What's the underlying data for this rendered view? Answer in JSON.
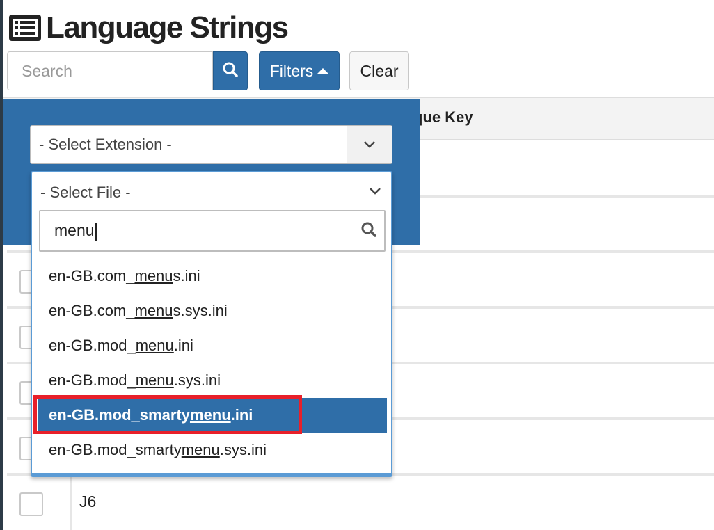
{
  "page": {
    "title": "Language Strings"
  },
  "toolbar": {
    "search_placeholder": "Search",
    "filters_label": "Filters",
    "clear_label": "Clear"
  },
  "table": {
    "header_partial": "que Key",
    "visible_cell": "J6"
  },
  "filters": {
    "extension_placeholder": "- Select Extension -",
    "file_placeholder": "- Select File -",
    "file_search_value": "menu",
    "options": [
      {
        "pre": "en-GB.com_",
        "match": "menu",
        "post": "s.ini"
      },
      {
        "pre": "en-GB.com_",
        "match": "menu",
        "post": "s.sys.ini"
      },
      {
        "pre": "en-GB.mod_",
        "match": "menu",
        "post": ".ini"
      },
      {
        "pre": "en-GB.mod_",
        "match": "menu",
        "post": ".sys.ini"
      },
      {
        "pre": "en-GB.mod_smarty",
        "match": "menu",
        "post": ".ini",
        "selected": true
      },
      {
        "pre": "en-GB.mod_smarty",
        "match": "menu",
        "post": ".sys.ini"
      }
    ]
  },
  "colors": {
    "primary": "#2f6ea8",
    "highlight_border": "#e8202a",
    "dropdown_border": "#5b9bd5"
  },
  "icons": [
    "list-icon",
    "search-icon",
    "caret-up-icon",
    "chevron-down-icon"
  ]
}
